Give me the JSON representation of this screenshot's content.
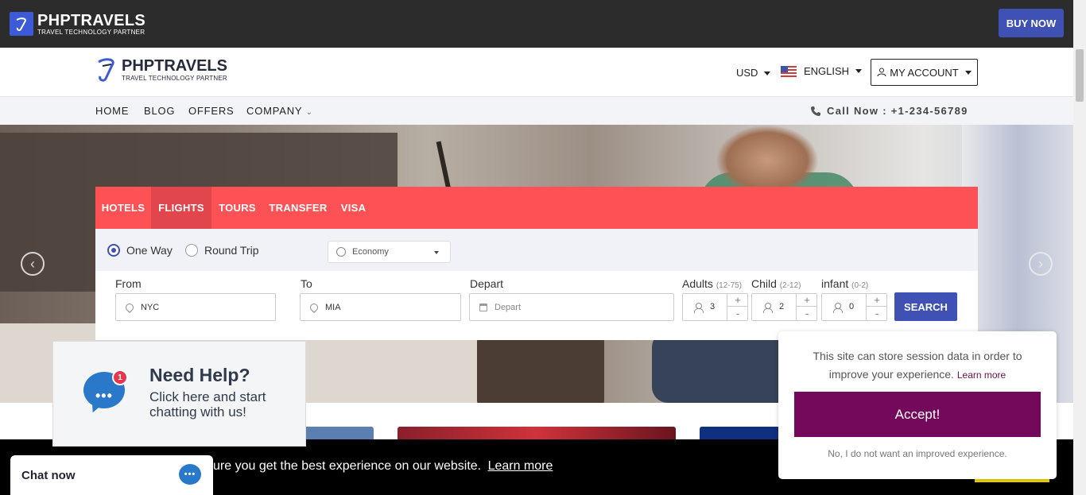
{
  "topbar": {
    "brand": "PHPTRAVELS",
    "tagline": "TRAVEL TECHNOLOGY PARTNER",
    "buy_label": "BUY NOW"
  },
  "header": {
    "brand": "PHPTRAVELS",
    "tagline": "TRAVEL TECHNOLOGY PARTNER",
    "currency": "USD",
    "language": "ENGLISH",
    "account_label": "MY ACCOUNT"
  },
  "nav": {
    "items": [
      "HOME",
      "BLOG",
      "OFFERS",
      "COMPANY"
    ],
    "call": "Call Now : +1-234-56789"
  },
  "search": {
    "tabs": [
      "HOTELS",
      "FLIGHTS",
      "TOURS",
      "TRANSFER",
      "VISA"
    ],
    "active_tab": "FLIGHTS",
    "trip_types": [
      "One Way",
      "Round Trip"
    ],
    "selected_trip": "One Way",
    "cabin_class": "Economy",
    "from_label": "From",
    "from_value": "NYC",
    "to_label": "To",
    "to_value": "MIA",
    "depart_label": "Depart",
    "depart_placeholder": "Depart",
    "adults_label": "Adults",
    "adults_range": "(12-75)",
    "adults_value": "3",
    "child_label": "Child",
    "child_range": "(2-12)",
    "child_value": "2",
    "infant_label": "infant",
    "infant_range": "(0-2)",
    "infant_value": "0",
    "plus": "+",
    "minus": "-",
    "search_label": "SEARCH"
  },
  "help_widget": {
    "badge": "1",
    "title": "Need Help?",
    "subtitle": "Click here and start chatting with us!"
  },
  "chat": {
    "label": "Chat now"
  },
  "cookie_bar": {
    "text": "ure you get the best experience on our website.",
    "link": "Learn more"
  },
  "consent": {
    "message": "This site can store session data in order to improve your experience.",
    "link": "Learn more",
    "accept": "Accept!",
    "decline": "No, I do not want an improved experience."
  },
  "colors": {
    "accent": "#3f51b5",
    "tab_bar": "#fd5255",
    "consent_accept": "#74085a"
  }
}
